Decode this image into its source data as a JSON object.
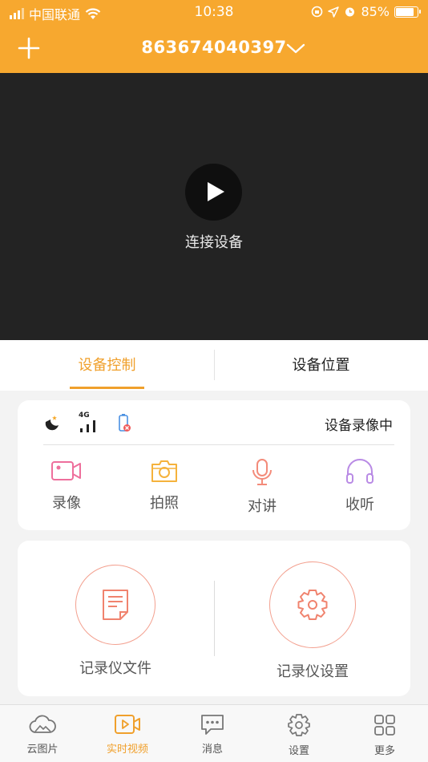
{
  "status_bar": {
    "carrier": "中国联通",
    "time": "10:38",
    "battery_percent": "85%",
    "battery_level": 0.85
  },
  "header": {
    "device_id": "863674040397"
  },
  "video": {
    "connect_label": "连接设备"
  },
  "tabs": [
    {
      "label": "设备控制",
      "active": true
    },
    {
      "label": "设备位置",
      "active": false
    }
  ],
  "device_status": {
    "signal_label": "4G",
    "recording_status": "设备录像中"
  },
  "actions": [
    {
      "label": "录像",
      "icon": "video-camera-icon",
      "color": "#ee6f9c"
    },
    {
      "label": "拍照",
      "icon": "camera-icon",
      "color": "#f5b23c"
    },
    {
      "label": "对讲",
      "icon": "microphone-icon",
      "color": "#f38b7a"
    },
    {
      "label": "收听",
      "icon": "headphones-icon",
      "color": "#b98be5"
    }
  ],
  "recorder": {
    "files_label": "记录仪文件",
    "settings_label": "记录仪设置"
  },
  "bottom_nav": [
    {
      "label": "云图片",
      "icon": "cloud-picture-icon",
      "active": false
    },
    {
      "label": "实时视频",
      "icon": "live-video-icon",
      "active": true
    },
    {
      "label": "消息",
      "icon": "message-icon",
      "active": false
    },
    {
      "label": "设置",
      "icon": "settings-icon",
      "active": false
    },
    {
      "label": "更多",
      "icon": "more-grid-icon",
      "active": false
    }
  ],
  "colors": {
    "brand": "#f7a82f",
    "accent": "#f0a02c",
    "video_bg": "#232323",
    "recorder_circle": "#f3a08f"
  }
}
